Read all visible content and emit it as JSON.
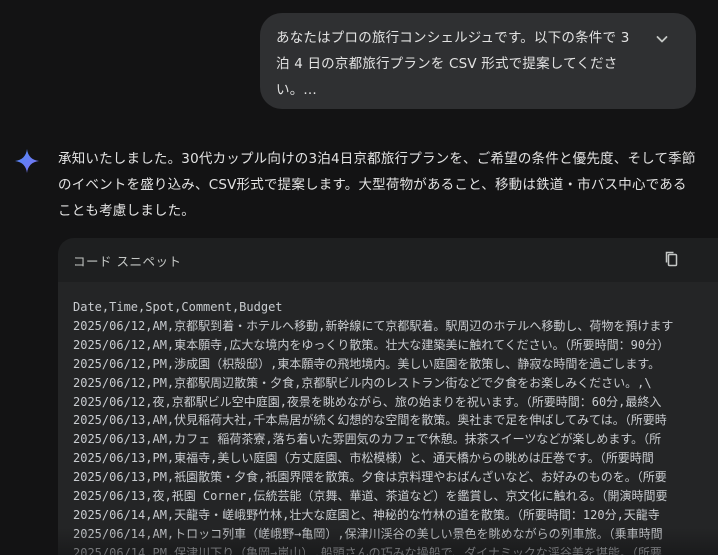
{
  "user_prompt": {
    "text": "あなたはプロの旅行コンシェルジュです。以下の条件で 3泊 4 日の京都旅行プランを CSV 形式で提案してください。..."
  },
  "assistant": {
    "reply": "承知いたしました。30代カップル向けの3泊4日京都旅行プランを、ご希望の条件と優先度、そして季節のイベントを盛り込み、CSV形式で提案します。大型荷物があること、移動は鉄道・市バス中心であることも考慮しました。"
  },
  "code_block": {
    "title": "コード スニペット",
    "lines": [
      "Date,Time,Spot,Comment,Budget",
      "2025/06/12,AM,京都駅到着・ホテルへ移動,新幹線にて京都駅着。駅周辺のホテルへ移動し、荷物を預けます",
      "2025/06/12,AM,東本願寺,広大な境内をゆっくり散策。壮大な建築美に触れてください。（所要時間：90分）",
      "2025/06/12,PM,渉成園（枳殻邸）,東本願寺の飛地境内。美しい庭園を散策し、静寂な時間を過ごします。",
      "2025/06/12,PM,京都駅周辺散策・夕食,京都駅ビル内のレストラン街などで夕食をお楽しみください。,\\",
      "2025/06/12,夜,京都駅ビル空中庭園,夜景を眺めながら、旅の始まりを祝います。（所要時間：60分,最終入",
      "2025/06/13,AM,伏見稲荷大社,千本鳥居が続く幻想的な空間を散策。奥社まで足を伸ばしてみては。（所要時",
      "2025/06/13,AM,カフェ 稲荷茶寮,落ち着いた雰囲気のカフェで休憩。抹茶スイーツなどが楽しめます。（所",
      "2025/06/13,PM,東福寺,美しい庭園（方丈庭園、市松模様）と、通天橋からの眺めは圧巻です。（所要時間",
      "2025/06/13,PM,祇園散策・夕食,祇園界隈を散策。夕食は京料理やおばんざいなど、お好みのものを。（所要",
      "2025/06/13,夜,祇園 Corner,伝統芸能（京舞、華道、茶道など）を鑑賞し、京文化に触れる。（開演時間要",
      "2025/06/14,AM,天龍寺・嵯峨野竹林,壮大な庭園と、神秘的な竹林の道を散策。（所要時間：120分,天龍寺",
      "2025/06/14,AM,トロッコ列車（嵯峨野→亀岡）,保津川渓谷の美しい景色を眺めながらの列車旅。（乗車時間",
      "2025/06/14,PM,保津川下り（亀岡→嵐山）,船頭さんの巧みな操船で、ダイナミックな渓谷美を堪能。（所要"
    ]
  }
}
